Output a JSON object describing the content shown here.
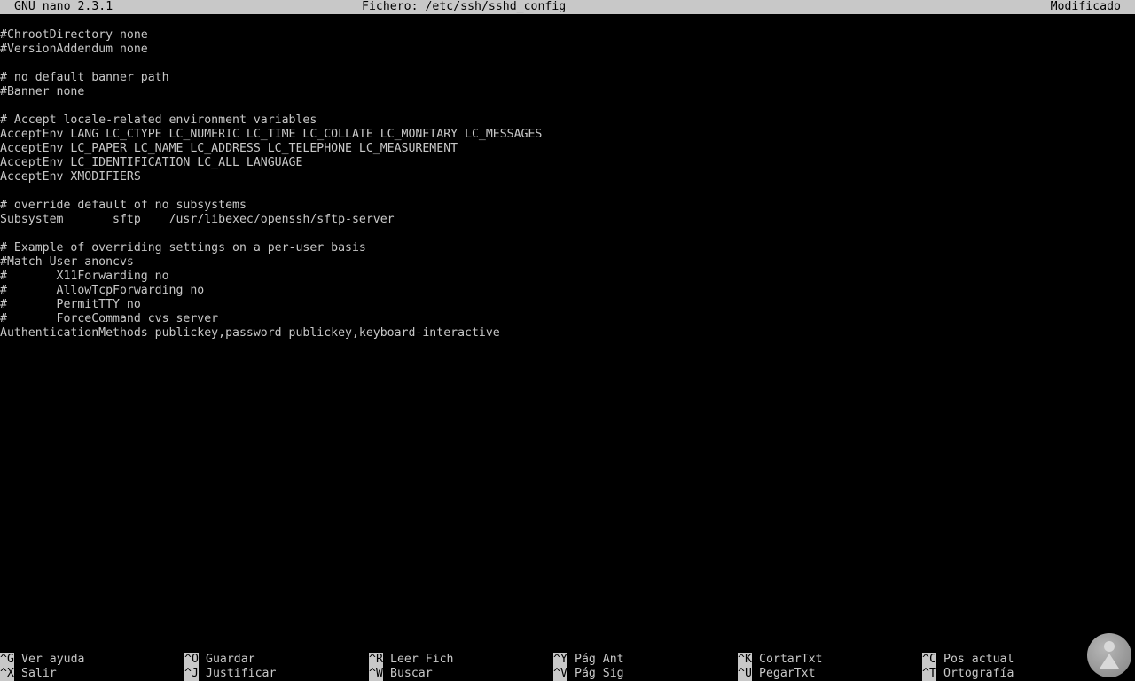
{
  "titlebar": {
    "app": "GNU nano 2.3.1",
    "file": "Fichero: /etc/ssh/sshd_config",
    "status": "Modificado"
  },
  "lines": [
    "#ChrootDirectory none",
    "#VersionAddendum none",
    "",
    "# no default banner path",
    "#Banner none",
    "",
    "# Accept locale-related environment variables",
    "AcceptEnv LANG LC_CTYPE LC_NUMERIC LC_TIME LC_COLLATE LC_MONETARY LC_MESSAGES",
    "AcceptEnv LC_PAPER LC_NAME LC_ADDRESS LC_TELEPHONE LC_MEASUREMENT",
    "AcceptEnv LC_IDENTIFICATION LC_ALL LANGUAGE",
    "AcceptEnv XMODIFIERS",
    "",
    "# override default of no subsystems",
    "Subsystem       sftp    /usr/libexec/openssh/sftp-server",
    "",
    "# Example of overriding settings on a per-user basis",
    "#Match User anoncvs",
    "#       X11Forwarding no",
    "#       AllowTcpForwarding no",
    "#       PermitTTY no",
    "#       ForceCommand cvs server",
    "AuthenticationMethods publickey,password publickey,keyboard-interactive"
  ],
  "shortcuts": [
    {
      "key": "^G",
      "label": "Ver ayuda"
    },
    {
      "key": "^O",
      "label": "Guardar"
    },
    {
      "key": "^R",
      "label": "Leer Fich"
    },
    {
      "key": "^Y",
      "label": "Pág Ant"
    },
    {
      "key": "^K",
      "label": "CortarTxt"
    },
    {
      "key": "^C",
      "label": "Pos actual"
    },
    {
      "key": "^X",
      "label": "Salir"
    },
    {
      "key": "^J",
      "label": "Justificar"
    },
    {
      "key": "^W",
      "label": "Buscar"
    },
    {
      "key": "^V",
      "label": "Pág Sig"
    },
    {
      "key": "^U",
      "label": "PegarTxt"
    },
    {
      "key": "^T",
      "label": "Ortografía"
    }
  ],
  "watermark": {
    "icon": "person-logo-icon"
  },
  "colors": {
    "background": "#000000",
    "foreground": "#c8c8c8",
    "bar": "#c8c8c8"
  }
}
